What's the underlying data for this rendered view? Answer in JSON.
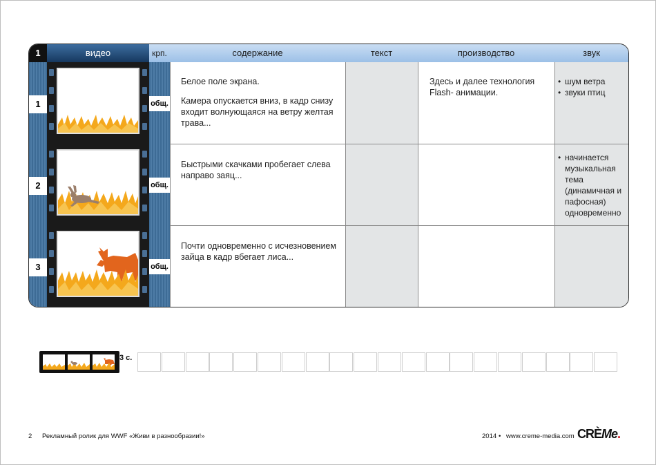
{
  "header": {
    "number": "1",
    "video": "видео",
    "krp": "крп.",
    "content": "содержание",
    "text": "текст",
    "production": "производство",
    "sound": "звук"
  },
  "rows": [
    {
      "num": "1",
      "shot": "общ.",
      "content_p1": "Белое поле экрана.",
      "content_p2": "Камера опускается вниз, в кадр снизу входит волнующаяся на ветру желтая трава...",
      "production": "Здесь и далее технология Flash- анимации.",
      "sound": [
        "шум ветра",
        "звуки птиц"
      ]
    },
    {
      "num": "2",
      "shot": "общ.",
      "content_p1": "Быстрыми скачками пробегает слева направо заяц...",
      "production": "",
      "sound": [
        "начинается музыкальная тема (динамичная и пафосная) одновременно"
      ]
    },
    {
      "num": "3",
      "shot": "общ.",
      "content_p1": "Почти  одновременно с исчезновением зайца в кадр вбегает лиса...",
      "production": "",
      "sound": []
    }
  ],
  "timeline": {
    "duration": "3 с.",
    "slot_count": 20
  },
  "footer": {
    "page": "2",
    "title": "Рекламный ролик для WWF «Живи в разнообразии!»",
    "year": "2014",
    "site": "www.creme-media.com",
    "logo_text": "CRÈMe."
  },
  "colors": {
    "header_blue": "#9cc0e7",
    "video_header": "#16385f",
    "grass": "#f4a81c",
    "fox": "#e2651d",
    "hare": "#9b7f6b"
  }
}
